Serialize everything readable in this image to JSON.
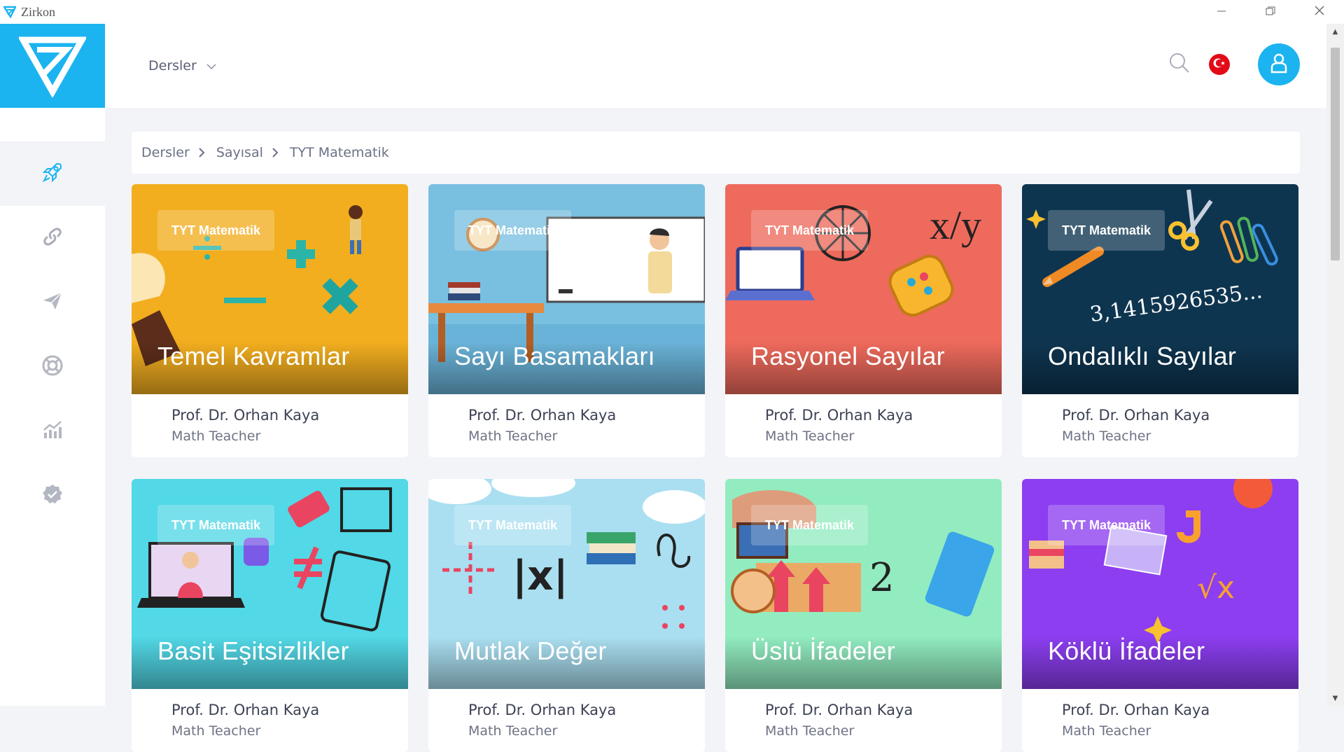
{
  "window": {
    "title": "Zirkon"
  },
  "header": {
    "menu_label": "Dersler"
  },
  "breadcrumb": [
    "Dersler",
    "Sayısal",
    "TYT Matematik"
  ],
  "colors": {
    "brand": "#1cb4f0",
    "flag": "#e30a17"
  },
  "cards": [
    {
      "tag": "TYT Matematik",
      "title": "Temel Kavramlar",
      "teacher": "Prof. Dr. Orhan Kaya",
      "role": "Math Teacher",
      "bg": "#f2ae1f"
    },
    {
      "tag": "TYT Matematik",
      "title": "Sayı Basamakları",
      "teacher": "Prof. Dr. Orhan Kaya",
      "role": "Math Teacher",
      "bg": "#79bfe0"
    },
    {
      "tag": "TYT Matematik",
      "title": "Rasyonel Sayılar",
      "teacher": "Prof. Dr. Orhan Kaya",
      "role": "Math Teacher",
      "bg": "#ee6a5c"
    },
    {
      "tag": "TYT Matematik",
      "title": "Ondalıklı Sayılar",
      "teacher": "Prof. Dr. Orhan Kaya",
      "role": "Math Teacher",
      "bg": "#0e3550"
    },
    {
      "tag": "TYT Matematik",
      "title": "Basit Eşitsizlikler",
      "teacher": "Prof. Dr. Orhan Kaya",
      "role": "Math Teacher",
      "bg": "#52d8e6"
    },
    {
      "tag": "TYT Matematik",
      "title": "Mutlak Değer",
      "teacher": "Prof. Dr. Orhan Kaya",
      "role": "Math Teacher",
      "bg": "#aadff1"
    },
    {
      "tag": "TYT Matematik",
      "title": "Üslü İfadeler",
      "teacher": "Prof. Dr. Orhan Kaya",
      "role": "Math Teacher",
      "bg": "#92ecc0"
    },
    {
      "tag": "TYT Matematik",
      "title": "Köklü İfadeler",
      "teacher": "Prof. Dr. Orhan Kaya",
      "role": "Math Teacher",
      "bg": "#8c3ef0"
    }
  ],
  "card_art_text": {
    "pi": "3,1415926535...",
    "abs": "|x|",
    "div": "x/y",
    "exp": "2",
    "neq": "≠",
    "root": "√x"
  },
  "icons": [
    "zirkon-logo-icon",
    "minimize-icon",
    "maximize-icon",
    "close-icon",
    "rocket-icon",
    "link-icon",
    "send-icon",
    "lifebuoy-icon",
    "chart-icon",
    "badge-check-icon",
    "chevron-down-icon",
    "search-icon",
    "turkey-flag-icon",
    "user-icon",
    "chevron-right-icon"
  ]
}
